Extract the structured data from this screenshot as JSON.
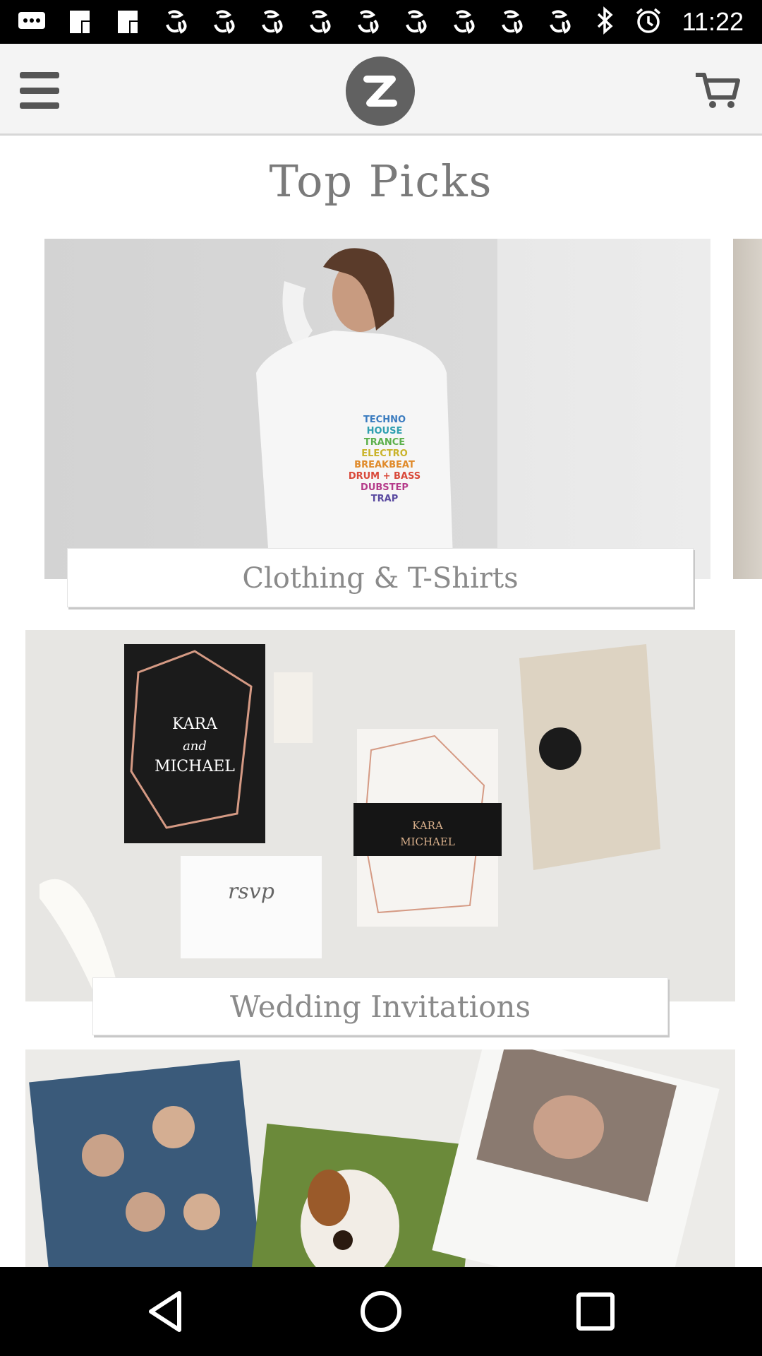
{
  "status_bar": {
    "time": "11:22",
    "left_icons": [
      "message-icon",
      "news-icon",
      "news-icon",
      "fan-icon",
      "fan-icon",
      "fan-icon",
      "fan-icon",
      "fan-icon",
      "fan-icon",
      "fan-icon",
      "fan-icon"
    ],
    "right_icons": [
      "bluetooth-icon",
      "alarm-icon"
    ]
  },
  "app_bar": {
    "menu_icon": "hamburger-menu-icon",
    "logo_letter": "Z",
    "cart_icon": "shopping-cart-icon"
  },
  "main": {
    "title": "Top Picks",
    "cards": [
      {
        "label": "Clothing & T-Shirts",
        "image": "woman-in-white-long-sleeve-shirt"
      },
      {
        "label": "Wedding Invitations",
        "image": "wedding-invitation-set"
      },
      {
        "label": "",
        "image": "photo-calendars"
      }
    ]
  },
  "nav_bar": {
    "back_icon": "back-icon",
    "home_icon": "home-icon",
    "recents_icon": "recents-icon"
  }
}
